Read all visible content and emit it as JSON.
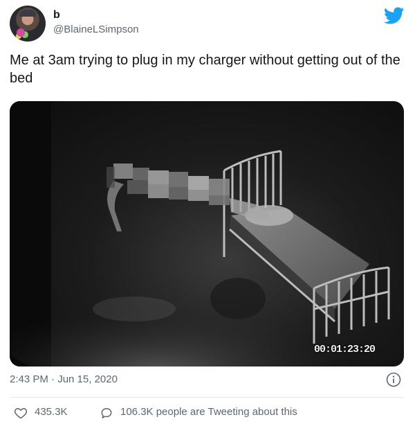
{
  "user": {
    "display_name": "b",
    "handle": "@BlaineLSimpson",
    "avatar_icon": "avatar-photo"
  },
  "brand": {
    "icon": "twitter-bird-icon",
    "color": "#1da1f2"
  },
  "tweet": {
    "text": "Me at 3am trying to plug in my charger without getting out of the bed",
    "media_timestamp": "00:01:23:20"
  },
  "meta": {
    "posted_at": "2:43 PM · Jun 15, 2020",
    "info_icon": "info-icon"
  },
  "actions": {
    "like_icon": "heart-icon",
    "like_count": "435.3K",
    "reply_icon": "speech-bubble-icon",
    "tweeting_text": "106.3K people are Tweeting about this"
  }
}
